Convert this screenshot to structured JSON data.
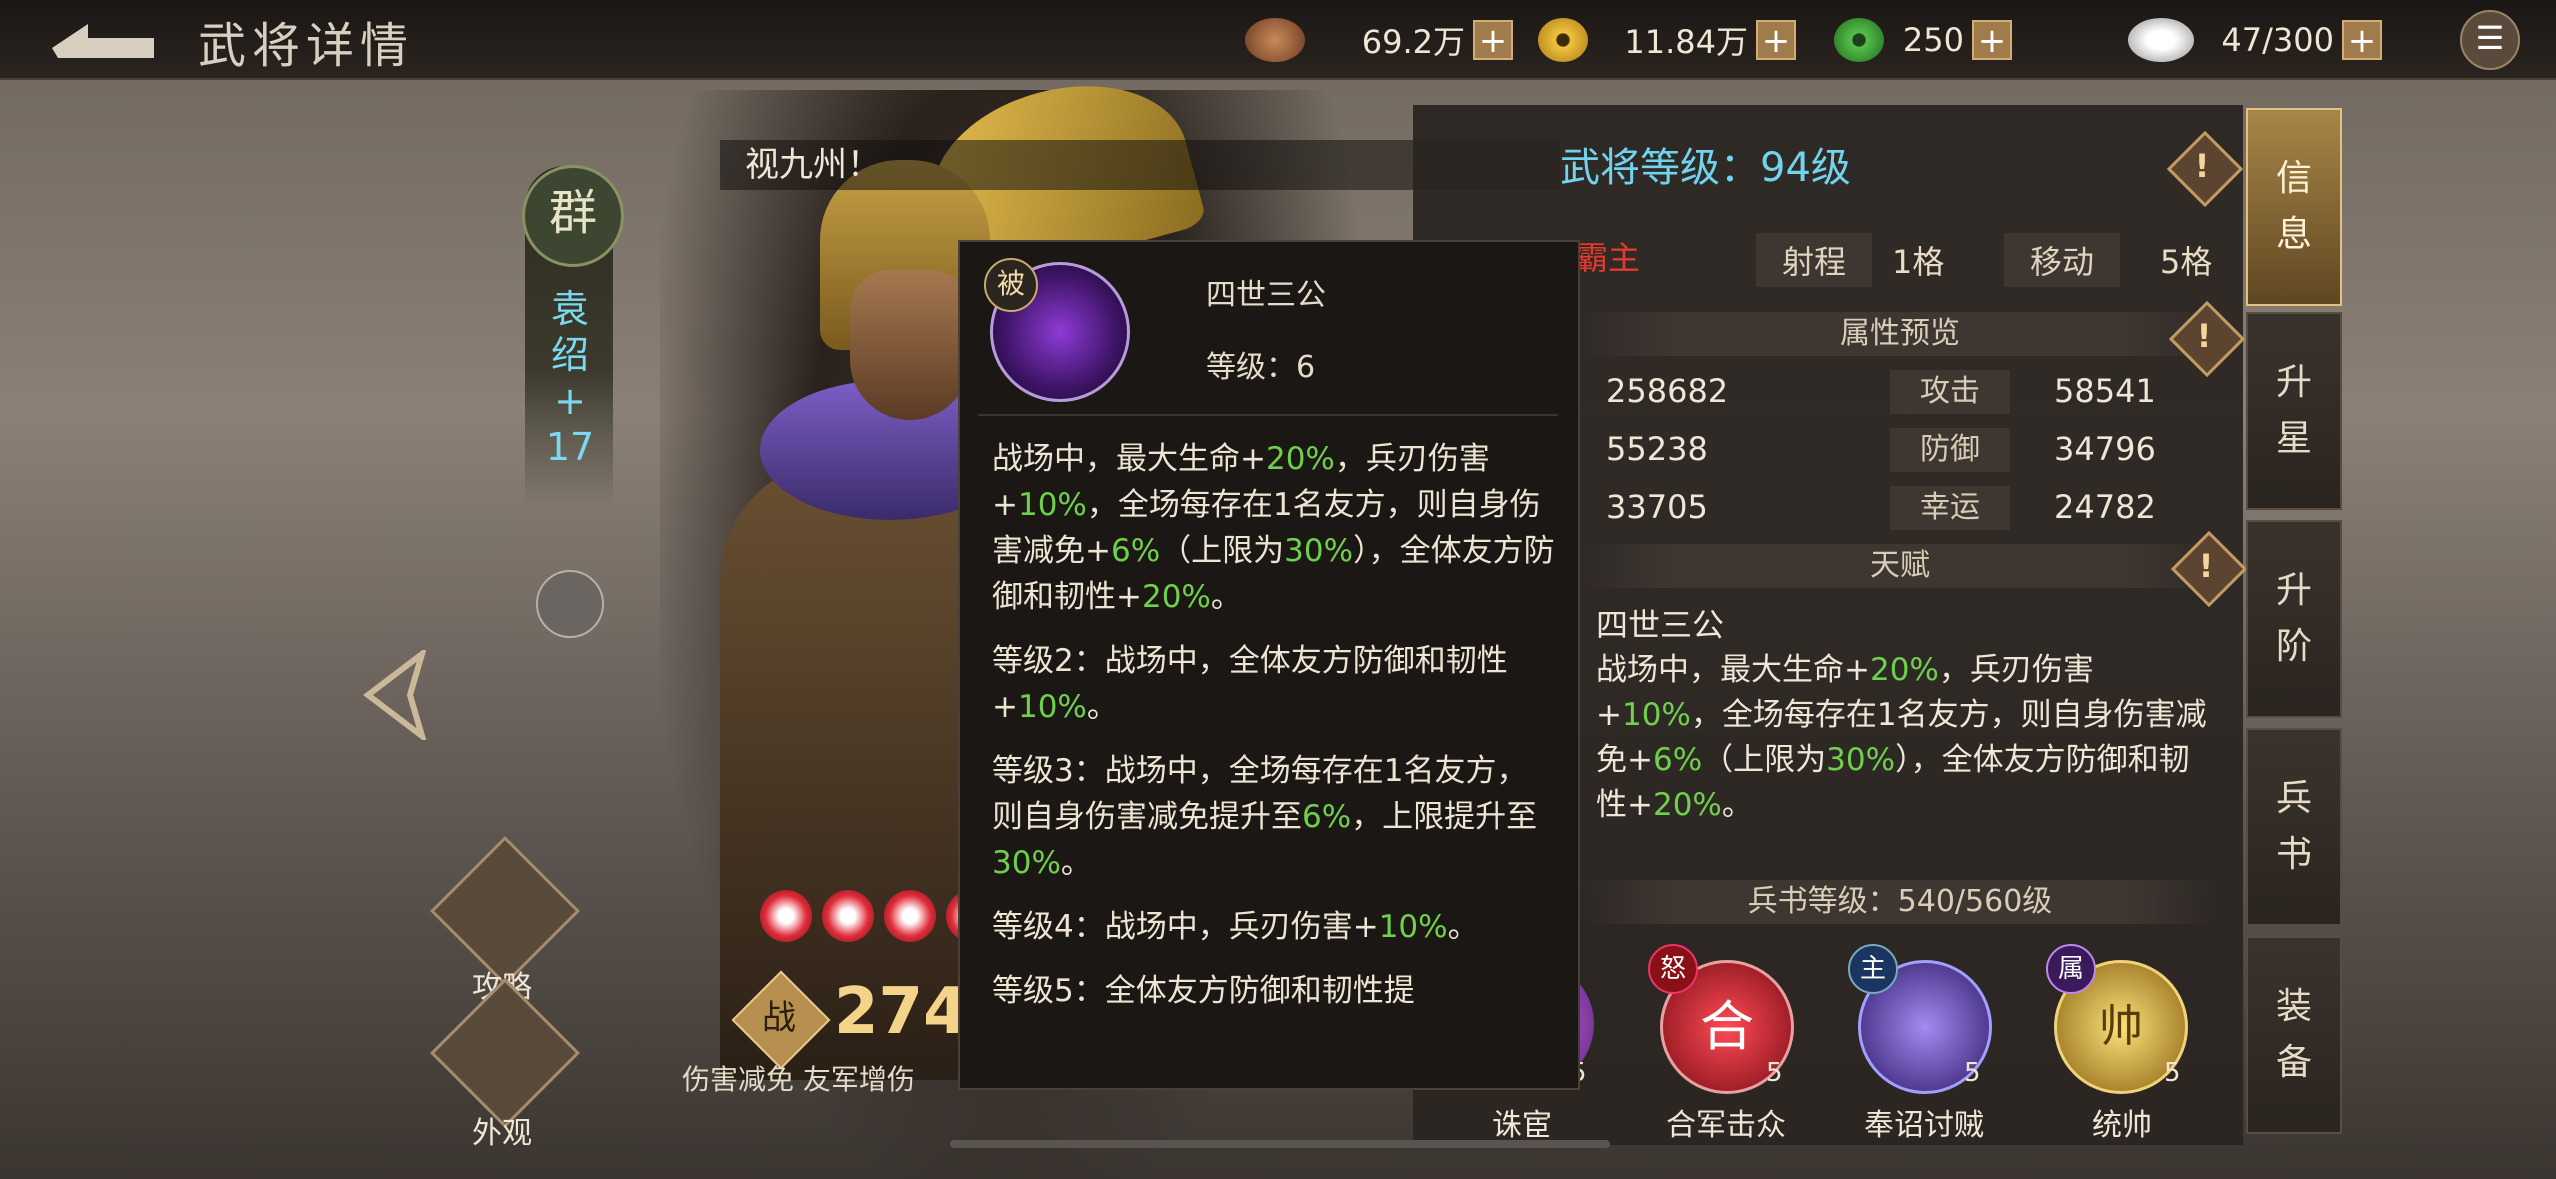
{
  "header": {
    "title": "武将详情",
    "resources": [
      {
        "icon": "coins-icon",
        "value": "69.2万"
      },
      {
        "icon": "gold-coin-icon",
        "value": "11.84万"
      },
      {
        "icon": "jade-icon",
        "value": "250"
      },
      {
        "icon": "stamina-icon",
        "value": "47/300"
      }
    ],
    "plus_label": "+"
  },
  "hero": {
    "faction": "群",
    "name": "袁绍+17",
    "name_chars": [
      "袁",
      "绍",
      "+",
      "17"
    ],
    "quote": "视九州！",
    "power": "274",
    "power_icon_label": "战",
    "power_desc": "伤害减免 友军增伤",
    "side_buttons": [
      {
        "label": "攻略"
      },
      {
        "label": "外观"
      }
    ],
    "stars_count": 4
  },
  "panel": {
    "level_label": "武将等级：94级",
    "title": "霸主",
    "range_label": "射程",
    "range_value": "1格",
    "move_label": "移动",
    "move_value": "5格",
    "attr_head": "属性预览",
    "stats_left": [
      "258682",
      "55238",
      "33705"
    ],
    "stats_right": [
      {
        "label": "攻击",
        "value": "58541"
      },
      {
        "label": "防御",
        "value": "34796"
      },
      {
        "label": "幸运",
        "value": "24782"
      }
    ],
    "talent_head": "天赋",
    "talent_name": "四世三公",
    "talent_desc_parts": [
      "战场中，最大生命+",
      "20%",
      "，兵刃伤害+",
      "10%",
      "，全场每存在1名友方，则自身伤害减免+",
      "6%",
      "（上限为",
      "30%",
      "），全体友方防御和韧性+",
      "20%",
      "。"
    ],
    "book_level": "兵书等级：540/560级",
    "skills": [
      {
        "name": "诛宦",
        "badge": "",
        "level": "5",
        "color": "#8b3fb8"
      },
      {
        "name": "合军击众",
        "badge": "怒",
        "level": "5",
        "color": "#c0202c"
      },
      {
        "name": "奉诏讨贼",
        "badge": "主",
        "level": "5",
        "color": "#5b3fb0"
      },
      {
        "name": "统帅",
        "badge": "属",
        "level": "5",
        "color": "#d2a530"
      }
    ],
    "skill_glyph_1": "合",
    "skill_glyph_3": "帅",
    "excl": "!"
  },
  "tabs": [
    {
      "label": "信息",
      "active": true
    },
    {
      "label": "升星",
      "active": false
    },
    {
      "label": "升阶",
      "active": false
    },
    {
      "label": "兵书",
      "active": false
    },
    {
      "label": "装备",
      "active": false
    }
  ],
  "popup": {
    "badge": "被",
    "name": "四世三公",
    "level": "等级：6",
    "paragraphs": [
      [
        "战场中，最大生命+",
        "20%",
        "，兵刃伤害+",
        "10%",
        "，全场每存在1名友方，则自身伤害减免+",
        "6%",
        "（上限为",
        "30%",
        "），全体友方防御和韧性+",
        "20%",
        "。"
      ],
      [
        "等级2：战场中，全体友方防御和韧性+",
        "10%",
        "。"
      ],
      [
        "等级3：战场中，全场每存在1名友方，则自身伤害减免提升至",
        "6%",
        "，上限提升至",
        "30%",
        "。"
      ],
      [
        "等级4：战场中，兵刃伤害+",
        "10%",
        "。"
      ],
      [
        "等级5：全体友方防御和韧性提"
      ]
    ]
  }
}
